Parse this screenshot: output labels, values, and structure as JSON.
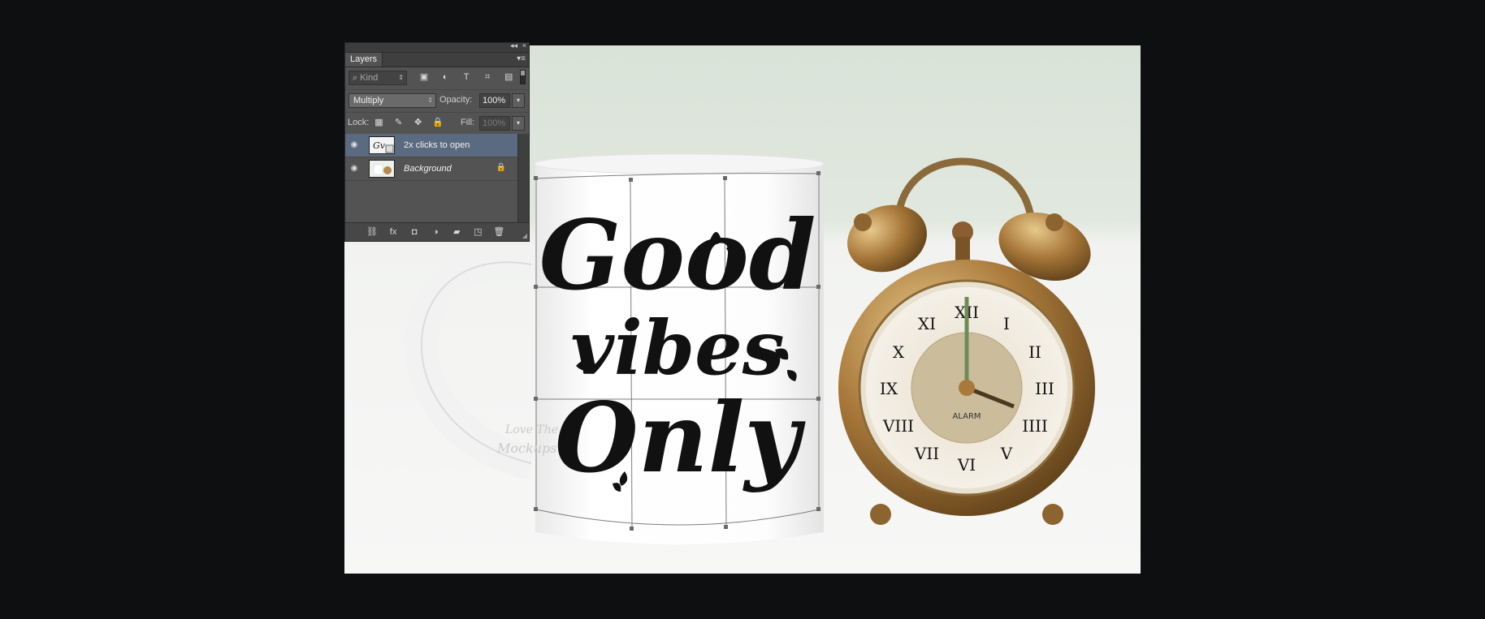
{
  "panel": {
    "title_tab": "Layers",
    "collapse_glyph": "◂◂",
    "close_glyph": "×",
    "menu_glyph": "▾≡",
    "filter": {
      "kind_label": "Kind",
      "search_glyph": "⌕",
      "icons": [
        "image-filter-icon",
        "adjustment-filter-icon",
        "type-filter-icon",
        "shape-filter-icon",
        "smart-object-filter-icon"
      ],
      "icon_glyphs": [
        "▣",
        "◐",
        "T",
        "⌗",
        "▤"
      ]
    },
    "blend": {
      "mode": "Multiply",
      "opacity_label": "Opacity:",
      "opacity_value": "100%"
    },
    "lock": {
      "label": "Lock:",
      "icon_glyphs": [
        "▦",
        "✎",
        "✥",
        "🔒"
      ],
      "fill_label": "Fill:",
      "fill_value": "100%"
    },
    "layers": [
      {
        "name": "2x clicks to open",
        "selected": true,
        "italic": false
      },
      {
        "name": "Background",
        "selected": false,
        "italic": true,
        "locked": true
      }
    ],
    "footer_glyphs": [
      "⛓",
      "fx",
      "◘",
      "◑",
      "▰",
      "◳",
      "🗑"
    ]
  },
  "artwork": {
    "mug_text": [
      "Good",
      "vibes",
      "Only"
    ],
    "watermark": [
      "Love The",
      "Mockups"
    ],
    "clock_label": "ALARM",
    "numerals": [
      "XII",
      "I",
      "II",
      "III",
      "IIII",
      "V",
      "VI",
      "VII",
      "VIII",
      "IX",
      "X",
      "XI"
    ]
  }
}
